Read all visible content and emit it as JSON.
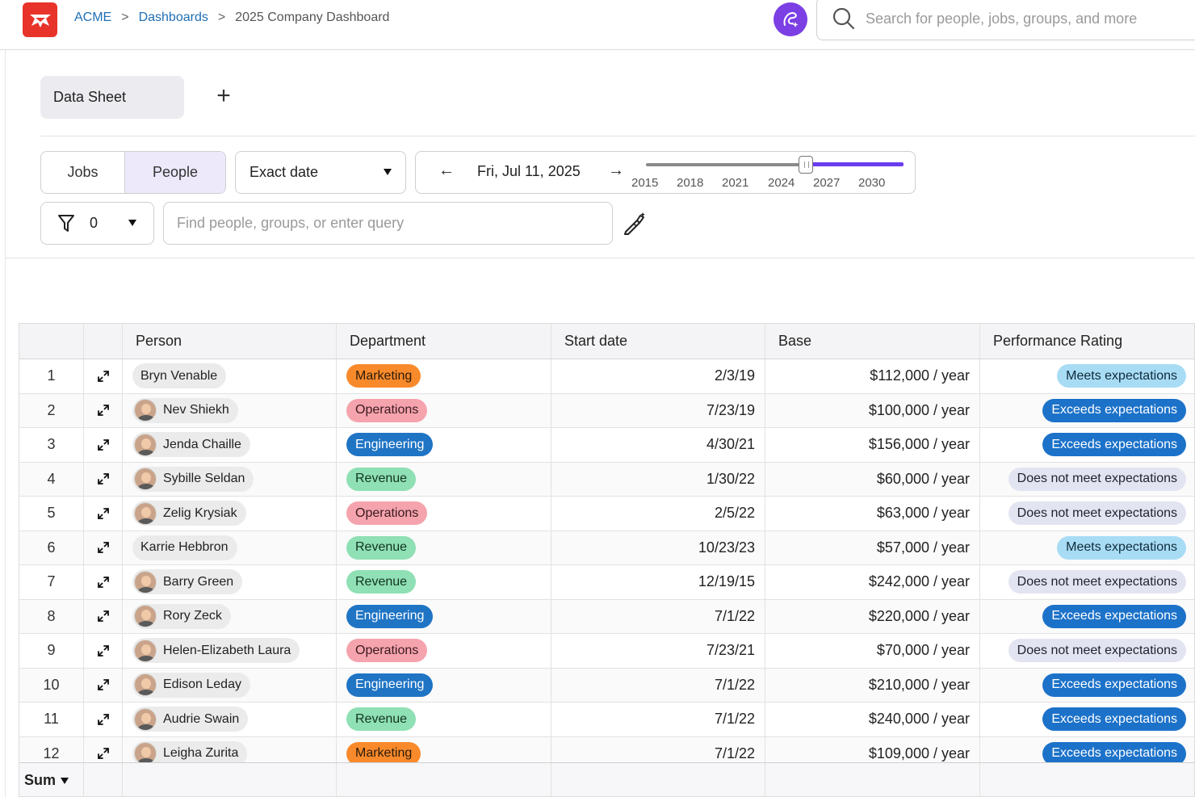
{
  "breadcrumb": {
    "org": "ACME",
    "sep1": ">",
    "section": "Dashboards",
    "sep2": ">",
    "current": "2025 Company Dashboard"
  },
  "search": {
    "placeholder": "Search for people, jobs, groups, and more"
  },
  "tabs": {
    "active": "Data Sheet",
    "add_label": "+"
  },
  "view_toggle": {
    "jobs": "Jobs",
    "people": "People",
    "selected": "People"
  },
  "date_mode": {
    "value": "Exact date"
  },
  "date_nav": {
    "prev": "←",
    "next": "→",
    "date": "Fri, Jul 11, 2025",
    "ticks": [
      "2015",
      "2018",
      "2021",
      "2024",
      "2027",
      "2030"
    ],
    "slider_position_year": 2025
  },
  "filter": {
    "count": "0"
  },
  "query": {
    "placeholder": "Find people, groups, or enter query"
  },
  "table": {
    "headers": {
      "person": "Person",
      "department": "Department",
      "start": "Start date",
      "base": "Base",
      "rating": "Performance Rating"
    },
    "rows": [
      {
        "num": "1",
        "person": "Bryn Venable",
        "avatar": false,
        "dept": "Marketing",
        "start": "2/3/19",
        "base": "$112,000 / year",
        "rating": "Meets expectations"
      },
      {
        "num": "2",
        "person": "Nev Shiekh",
        "avatar": true,
        "dept": "Operations",
        "start": "7/23/19",
        "base": "$100,000 / year",
        "rating": "Exceeds expectations"
      },
      {
        "num": "3",
        "person": "Jenda Chaille",
        "avatar": true,
        "dept": "Engineering",
        "start": "4/30/21",
        "base": "$156,000 / year",
        "rating": "Exceeds expectations"
      },
      {
        "num": "4",
        "person": "Sybille Seldan",
        "avatar": true,
        "dept": "Revenue",
        "start": "1/30/22",
        "base": "$60,000 / year",
        "rating": "Does not meet expectations"
      },
      {
        "num": "5",
        "person": "Zelig Krysiak",
        "avatar": true,
        "dept": "Operations",
        "start": "2/5/22",
        "base": "$63,000 / year",
        "rating": "Does not meet expectations"
      },
      {
        "num": "6",
        "person": "Karrie Hebbron",
        "avatar": false,
        "dept": "Revenue",
        "start": "10/23/23",
        "base": "$57,000 / year",
        "rating": "Meets expectations"
      },
      {
        "num": "7",
        "person": "Barry Green",
        "avatar": true,
        "dept": "Revenue",
        "start": "12/19/15",
        "base": "$242,000 / year",
        "rating": "Does not meet expectations"
      },
      {
        "num": "8",
        "person": "Rory Zeck",
        "avatar": true,
        "dept": "Engineering",
        "start": "7/1/22",
        "base": "$220,000 / year",
        "rating": "Exceeds expectations"
      },
      {
        "num": "9",
        "person": "Helen-Elizabeth Laura",
        "avatar": true,
        "dept": "Operations",
        "start": "7/23/21",
        "base": "$70,000 / year",
        "rating": "Does not meet expectations"
      },
      {
        "num": "10",
        "person": "Edison Leday",
        "avatar": true,
        "dept": "Engineering",
        "start": "7/1/22",
        "base": "$210,000 / year",
        "rating": "Exceeds expectations"
      },
      {
        "num": "11",
        "person": "Audrie Swain",
        "avatar": true,
        "dept": "Revenue",
        "start": "7/1/22",
        "base": "$240,000 / year",
        "rating": "Exceeds expectations"
      },
      {
        "num": "12",
        "person": "Leigha Zurita",
        "avatar": true,
        "dept": "Marketing",
        "start": "7/1/22",
        "base": "$109,000 / year",
        "rating": "Exceeds expectations"
      }
    ],
    "footer": {
      "sum_label": "Sum"
    }
  },
  "colors": {
    "brand_logo": "#e8332a",
    "accent_purple": "#6a3df0",
    "dept": {
      "Marketing": {
        "bg": "#f98a2b",
        "fg": "#2a1a0a"
      },
      "Operations": {
        "bg": "#f5a3ad",
        "fg": "#3a1a1e"
      },
      "Engineering": {
        "bg": "#1f74c4",
        "fg": "#ffffff"
      },
      "Revenue": {
        "bg": "#8fe0b4",
        "fg": "#12331f"
      }
    },
    "rating": {
      "Meets expectations": {
        "bg": "#a8dcf5",
        "fg": "#0f2a3a"
      },
      "Exceeds expectations": {
        "bg": "#1c72c9",
        "fg": "#ffffff"
      },
      "Does not meet expectations": {
        "bg": "#e3e4f2",
        "fg": "#222233"
      }
    }
  }
}
